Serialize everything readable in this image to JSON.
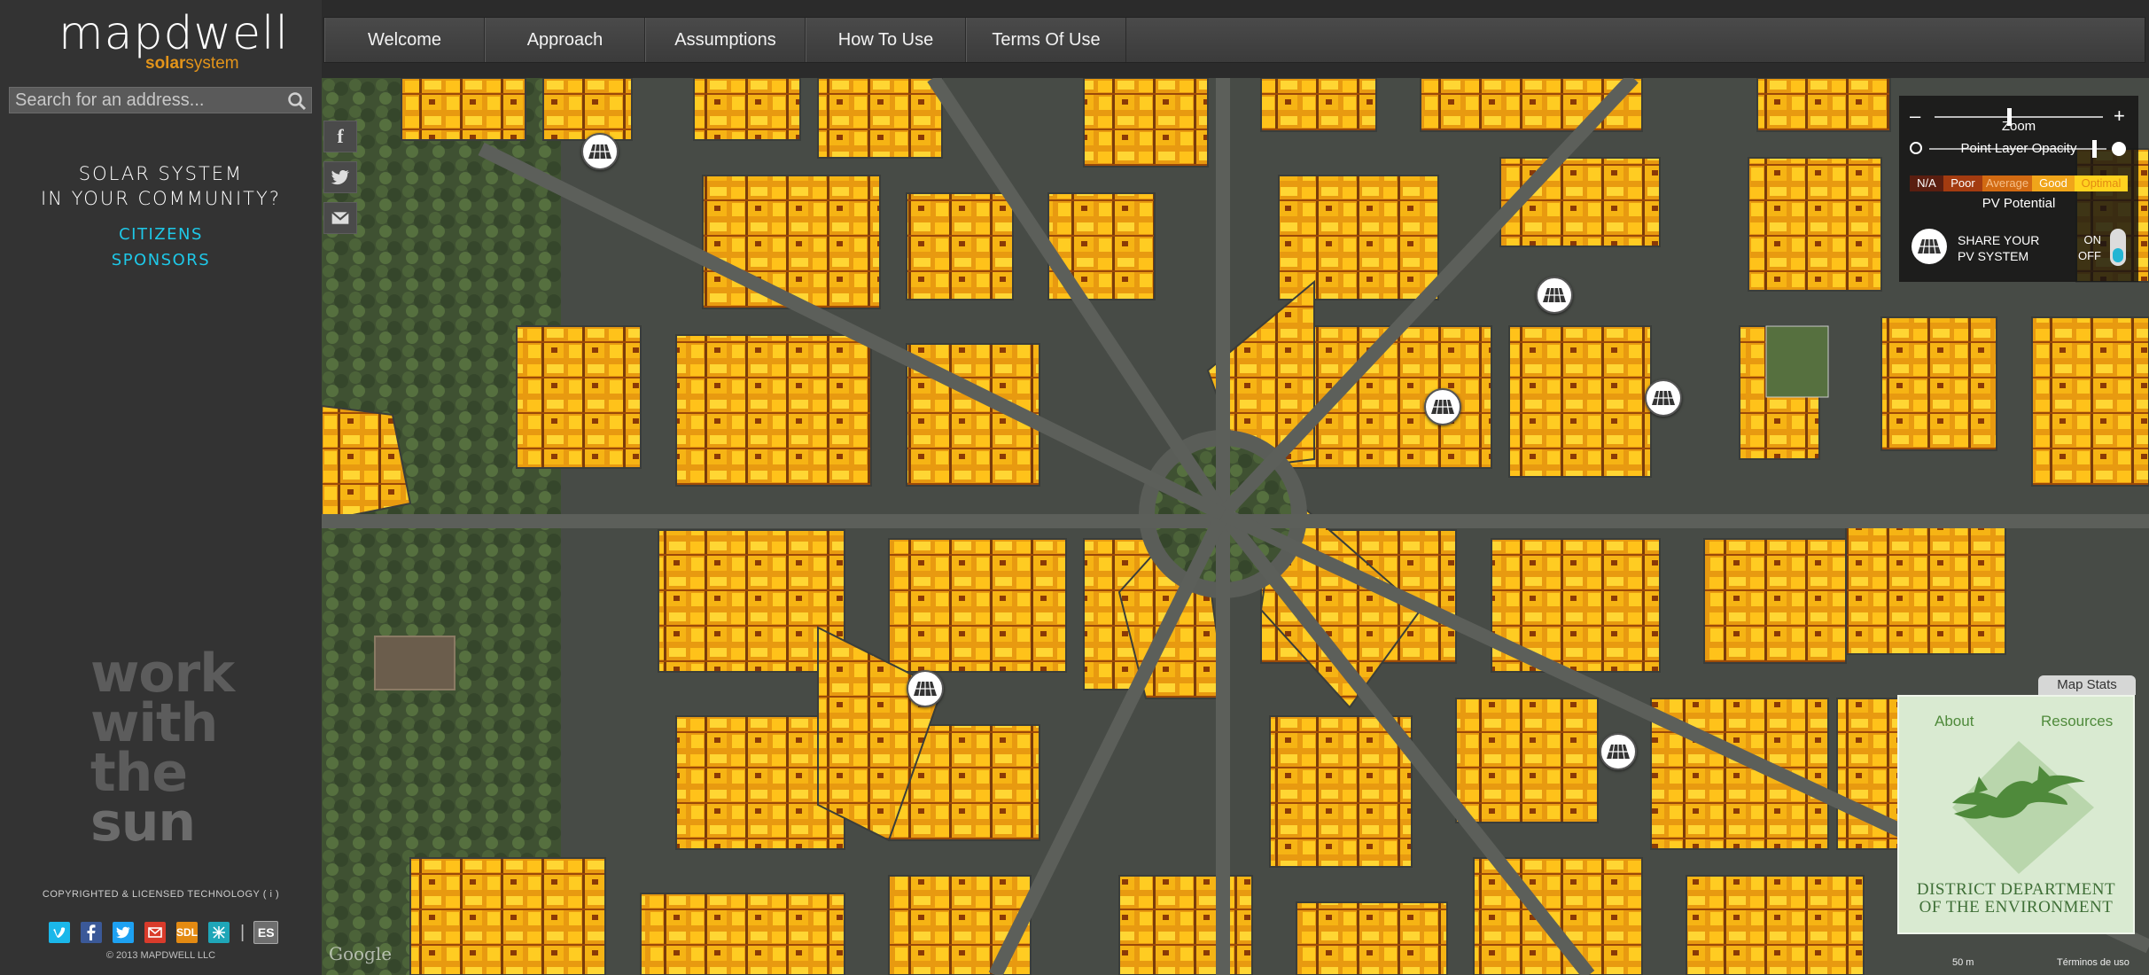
{
  "logo": {
    "wordmark": "mapdwell",
    "sub_a": "solar",
    "sub_b": "system"
  },
  "search": {
    "placeholder": "Search for an address..."
  },
  "promo": {
    "heading_line1": "SOLAR SYSTEM",
    "heading_line2": "IN YOUR COMMUNITY?",
    "link_citizens": "CITIZENS",
    "link_sponsors": "SPONSORS"
  },
  "tagline": [
    "work",
    "with",
    "the",
    "sun"
  ],
  "copyright": "COPYRIGHTED & LICENSED TECHNOLOGY ( i )",
  "footer_icons": [
    "vimeo-icon",
    "facebook-icon",
    "twitter-icon",
    "mail-icon",
    "sdl-icon",
    "partner-icon"
  ],
  "footer_sdl": "SDL",
  "footer_sep": "|",
  "language": "ES",
  "year_line": "© 2013 MAPDWELL LLC",
  "nav": {
    "tabs": [
      {
        "label": "Welcome"
      },
      {
        "label": "Approach"
      },
      {
        "label": "Assumptions"
      },
      {
        "label": "How To Use"
      },
      {
        "label": "Terms Of Use"
      }
    ]
  },
  "share_rail": {
    "facebook": "f"
  },
  "controls": {
    "zoom_minus": "–",
    "zoom_plus": "+",
    "zoom_label": "Zoom",
    "opacity_label": "Point Layer Opacity",
    "legend": [
      {
        "label": "N/A",
        "color": "#5a1e10"
      },
      {
        "label": "Poor",
        "color": "#a33b10"
      },
      {
        "label": "Average",
        "color": "#d26a12"
      },
      {
        "label": "Good",
        "color": "#f0a51a"
      },
      {
        "label": "Optimal",
        "color": "#ffd31f"
      }
    ],
    "pv_label": "PV Potential",
    "share_line1": "SHARE YOUR",
    "share_line2": "PV SYSTEM",
    "toggle_on": "ON",
    "toggle_off": "OFF"
  },
  "stats": {
    "tab": "Map Stats",
    "about": "About",
    "resources": "Resources",
    "org_line1": "DISTRICT DEPARTMENT",
    "org_line2": "OF THE ENVIRONMENT"
  },
  "map": {
    "attribution": "Google",
    "scale": "50 m",
    "terms": "Términos de uso"
  },
  "colors": {
    "accent_cyan": "#1ec8e8",
    "brand_orange": "#e3941a",
    "roof_optimal": "#ffc21a",
    "roof_good": "#f0a51a"
  }
}
